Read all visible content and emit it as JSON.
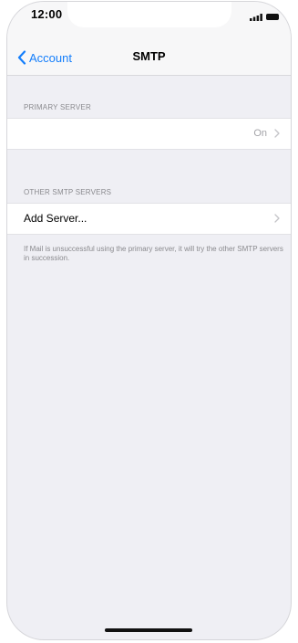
{
  "status_bar": {
    "time": "12:00",
    "icons": [
      "signal-icon",
      "battery-icon"
    ]
  },
  "nav": {
    "back_label": "Account",
    "title": "SMTP"
  },
  "sections": {
    "primary": {
      "header": "PRIMARY SERVER",
      "row_value": "On"
    },
    "other": {
      "header": "OTHER SMTP SERVERS",
      "row_label": "Add Server..."
    }
  },
  "footer": "If Mail is unsuccessful using the primary server, it will try the other SMTP servers in succession.",
  "colors": {
    "accent": "#147efb",
    "grouped_background": "#efeff4",
    "secondary_text": "#8a8a8e"
  }
}
